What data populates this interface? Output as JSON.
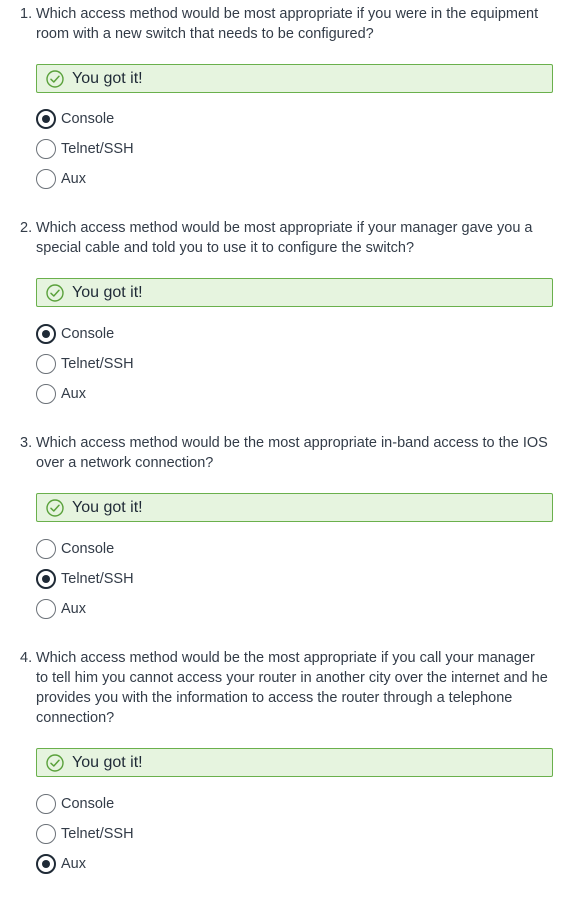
{
  "colors": {
    "success_bg": "#e6f4df",
    "success_border": "#6ab04c",
    "radio_selected": "#1f2a36",
    "text": "#333c48"
  },
  "questions": [
    {
      "number": "1.",
      "text": "Which access method would be most appropriate if you were in the equipment room with a new switch that needs to be configured?",
      "feedback": "You got it!",
      "feedback_icon": "check-circle-icon",
      "options": [
        {
          "label": "Console",
          "selected": true
        },
        {
          "label": "Telnet/SSH",
          "selected": false
        },
        {
          "label": "Aux",
          "selected": false
        }
      ]
    },
    {
      "number": "2.",
      "text": "Which access method would be most appropriate if your manager gave you a special cable and told you to use it to configure the switch?",
      "feedback": "You got it!",
      "feedback_icon": "check-circle-icon",
      "options": [
        {
          "label": "Console",
          "selected": true
        },
        {
          "label": "Telnet/SSH",
          "selected": false
        },
        {
          "label": "Aux",
          "selected": false
        }
      ]
    },
    {
      "number": "3.",
      "text": "Which access method would be the most appropriate in-band access to the IOS over a network connection?",
      "feedback": "You got it!",
      "feedback_icon": "check-circle-icon",
      "options": [
        {
          "label": "Console",
          "selected": false
        },
        {
          "label": "Telnet/SSH",
          "selected": true
        },
        {
          "label": "Aux",
          "selected": false
        }
      ]
    },
    {
      "number": "4.",
      "text": "Which access method would be the most appropriate if you call your manager to tell him you cannot access your router in another city over the internet and he provides you with the information to access the router through a telephone connection?",
      "feedback": "You got it!",
      "feedback_icon": "check-circle-icon",
      "options": [
        {
          "label": "Console",
          "selected": false
        },
        {
          "label": "Telnet/SSH",
          "selected": false
        },
        {
          "label": "Aux",
          "selected": true
        }
      ]
    }
  ]
}
